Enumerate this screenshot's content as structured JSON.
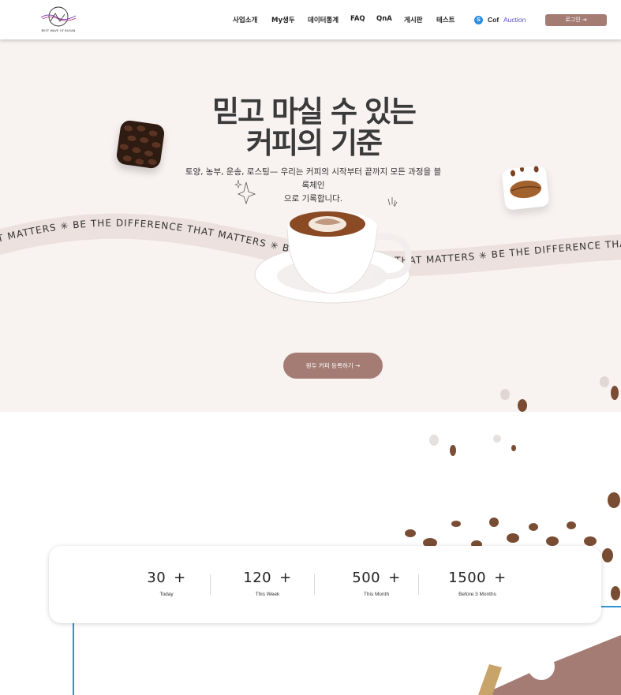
{
  "header": {
    "logo_text": "BEST WAVE OF BUSAN",
    "nav": [
      "사업소개",
      "My생두",
      "데이터통계",
      "FAQ",
      "QnA",
      "게시판",
      "테스트"
    ],
    "coin_symbol": "S",
    "cof_label": "Cof",
    "auction_label": "Auction",
    "login_label": "로그인 ⇥"
  },
  "hero": {
    "title_line1": "믿고 마실 수 있는",
    "title_line2": "커피의 기준",
    "desc_line1": "토양, 농부, 운송, 로스팅— 우리는 커피의 시작부터 끝까지 모든 과정을 블록체인",
    "desc_line2": "으로 기록합니다.",
    "ribbon_text": "BE THE DIFFERENCE THAT MATTERS",
    "cta_label": "원두 커피 등록하기 →"
  },
  "stats": [
    {
      "value": "30",
      "suffix": "+",
      "label": "Today"
    },
    {
      "value": "120",
      "suffix": "+",
      "label": "This Week"
    },
    {
      "value": "500",
      "suffix": "+",
      "label": "This Month"
    },
    {
      "value": "1500",
      "suffix": "+",
      "label": "Before 3 Months"
    }
  ],
  "colors": {
    "accent": "#a47c74",
    "hero_bg": "#f8f2f1",
    "ribbon": "#ece1de",
    "auction": "#5a52b8",
    "outline": "#2b94d7"
  }
}
